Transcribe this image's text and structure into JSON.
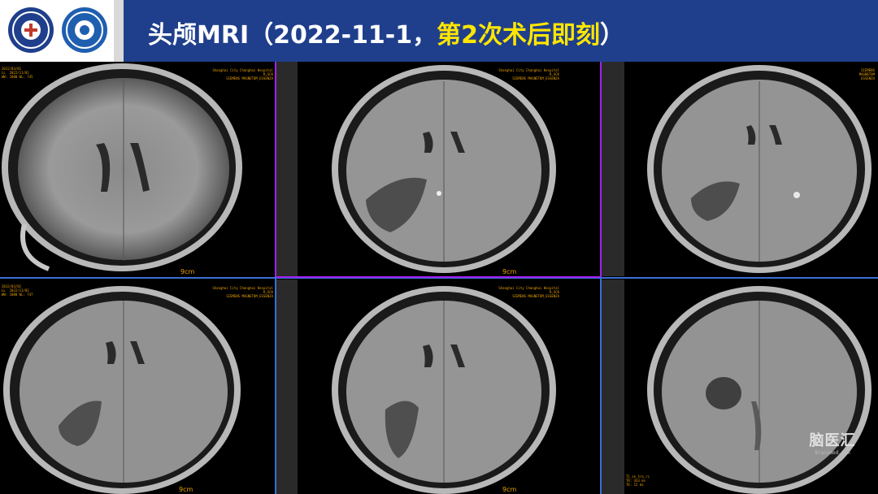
{
  "header": {
    "title_main": "头颅MRI（2022-11-1，",
    "title_highlight": "第2次术后即刻",
    "title_end": "）"
  },
  "scale_label": "9cm",
  "watermark": {
    "text": "脑医汇",
    "sub": "Brainmed.com"
  },
  "colors": {
    "header_bg": "#1f3f8c",
    "highlight": "#ffe600",
    "divider_blue": "#3a6fd8",
    "divider_purple": "#a020f0",
    "overlay_text": "#e8a000"
  }
}
